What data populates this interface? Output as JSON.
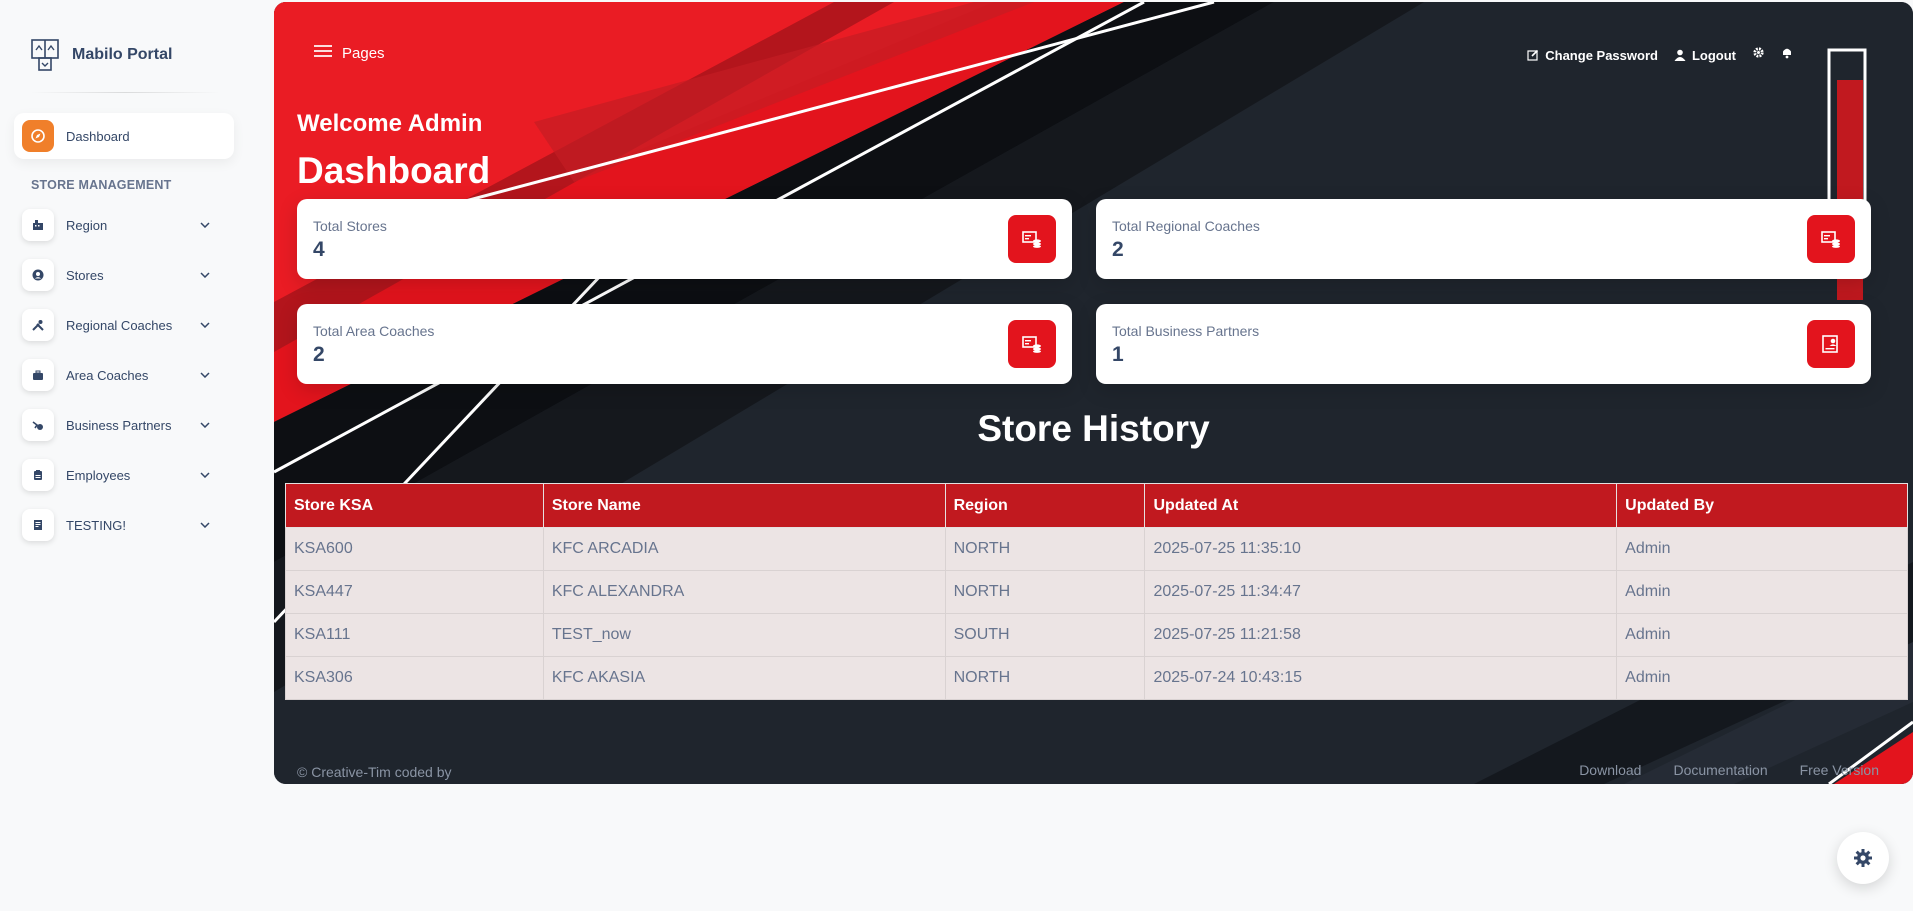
{
  "brand": {
    "name": "Mabilo Portal"
  },
  "sidebar": {
    "dashboard": {
      "label": "Dashboard",
      "icon": "compass-icon"
    },
    "section_title": "STORE MANAGEMENT",
    "items": [
      {
        "label": "Region",
        "icon": "building-icon"
      },
      {
        "label": "Stores",
        "icon": "user-circle-icon"
      },
      {
        "label": "Regional Coaches",
        "icon": "tools-icon"
      },
      {
        "label": "Area Coaches",
        "icon": "briefcase-icon"
      },
      {
        "label": "Business Partners",
        "icon": "handshake-icon"
      },
      {
        "label": "Employees",
        "icon": "id-badge-icon"
      },
      {
        "label": "TESTING!",
        "icon": "document-icon"
      }
    ]
  },
  "topbar": {
    "breadcrumb": "Pages",
    "change_password": "Change Password",
    "logout": "Logout"
  },
  "header": {
    "welcome": "Welcome Admin",
    "title": "Dashboard"
  },
  "stats": [
    {
      "label": "Total Stores",
      "value": "4",
      "icon": "store-icon"
    },
    {
      "label": "Total Regional Coaches",
      "value": "2",
      "icon": "store-icon"
    },
    {
      "label": "Total Area Coaches",
      "value": "2",
      "icon": "store-icon"
    },
    {
      "label": "Total Business Partners",
      "value": "1",
      "icon": "contact-card-icon"
    }
  ],
  "history": {
    "title": "Store History",
    "columns": [
      "Store KSA",
      "Store Name",
      "Region",
      "Updated At",
      "Updated By"
    ],
    "rows": [
      [
        "KSA600",
        "KFC ARCADIA",
        "NORTH",
        "2025-07-25 11:35:10",
        "Admin"
      ],
      [
        "KSA447",
        "KFC ALEXANDRA",
        "NORTH",
        "2025-07-25 11:34:47",
        "Admin"
      ],
      [
        "KSA111",
        "TEST_now",
        "SOUTH",
        "2025-07-25 11:21:58",
        "Admin"
      ],
      [
        "KSA306",
        "KFC AKASIA",
        "NORTH",
        "2025-07-24 10:43:15",
        "Admin"
      ]
    ]
  },
  "footer": {
    "copyright": "© Creative-Tim coded by",
    "links": [
      "Download",
      "Documentation",
      "Free Version"
    ]
  },
  "colors": {
    "accent": "#e3141d",
    "table_header": "#c1191f",
    "active_icon": "#f07f2a"
  }
}
